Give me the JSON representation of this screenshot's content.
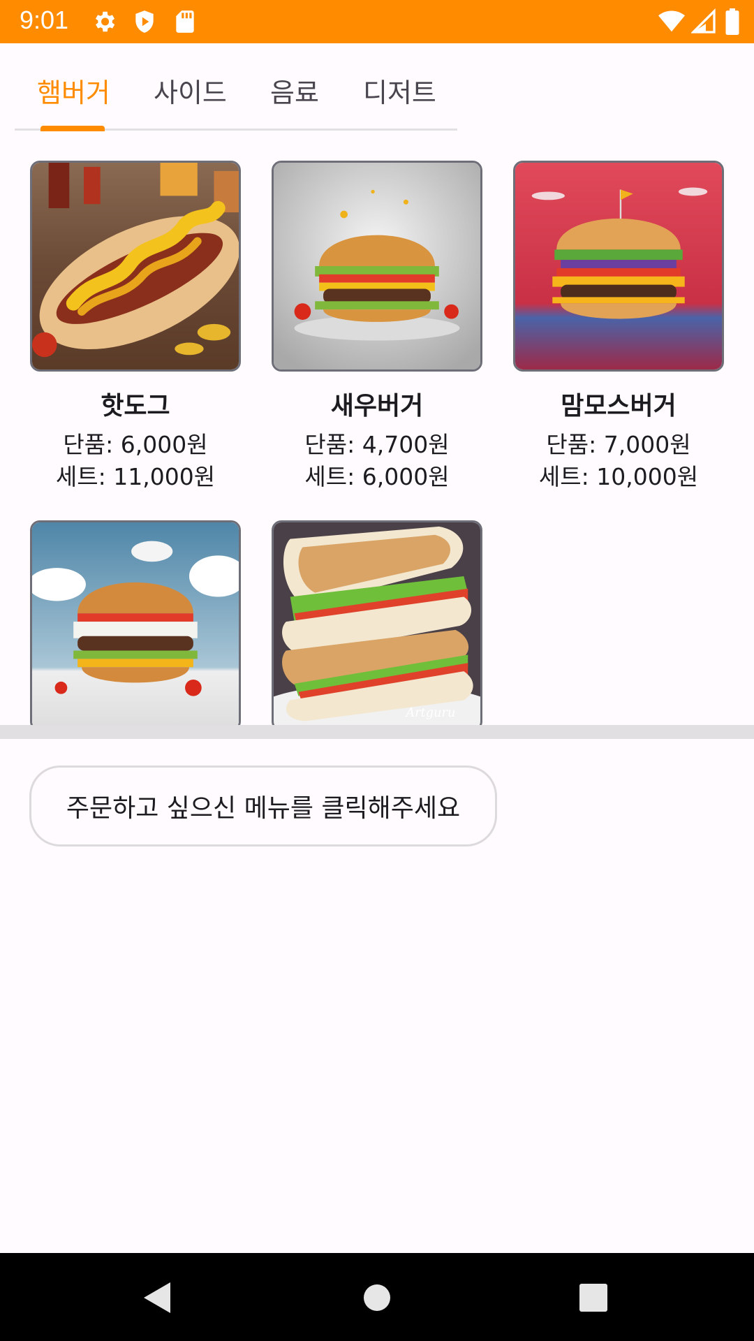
{
  "status_bar": {
    "time": "9:01",
    "left_icons": [
      "gear-icon",
      "shield-play-icon",
      "sd-card-icon"
    ],
    "right_icons": [
      "wifi-icon",
      "signal-icon",
      "battery-icon"
    ],
    "background": "#ff8c00"
  },
  "tabs": [
    {
      "label": "햄버거",
      "active": true
    },
    {
      "label": "사이드",
      "active": false
    },
    {
      "label": "음료",
      "active": false
    },
    {
      "label": "디저트",
      "active": false
    }
  ],
  "accent_color": "#ff8c00",
  "menu_items": [
    {
      "name": "핫도그",
      "single_price": "단품: 6,000원",
      "set_price": "세트: 11,000원",
      "image": "hotdog-image"
    },
    {
      "name": "새우버거",
      "single_price": "단품: 4,700원",
      "set_price": "세트: 6,000원",
      "image": "burger-gray-image"
    },
    {
      "name": "맘모스버거",
      "single_price": "단품: 7,000원",
      "set_price": "세트: 10,000원",
      "image": "burger-red-image"
    },
    {
      "name": "",
      "single_price": "",
      "set_price": "",
      "image": "burger-sky-image"
    },
    {
      "name": "",
      "single_price": "",
      "set_price": "",
      "image": "sandwich-image",
      "watermark": "Artguru"
    }
  ],
  "order_prompt": "주문하고 싶으신 메뉴를 클릭해주세요",
  "nav_bar": {
    "icons": [
      "back-icon",
      "home-icon",
      "recents-icon"
    ]
  }
}
